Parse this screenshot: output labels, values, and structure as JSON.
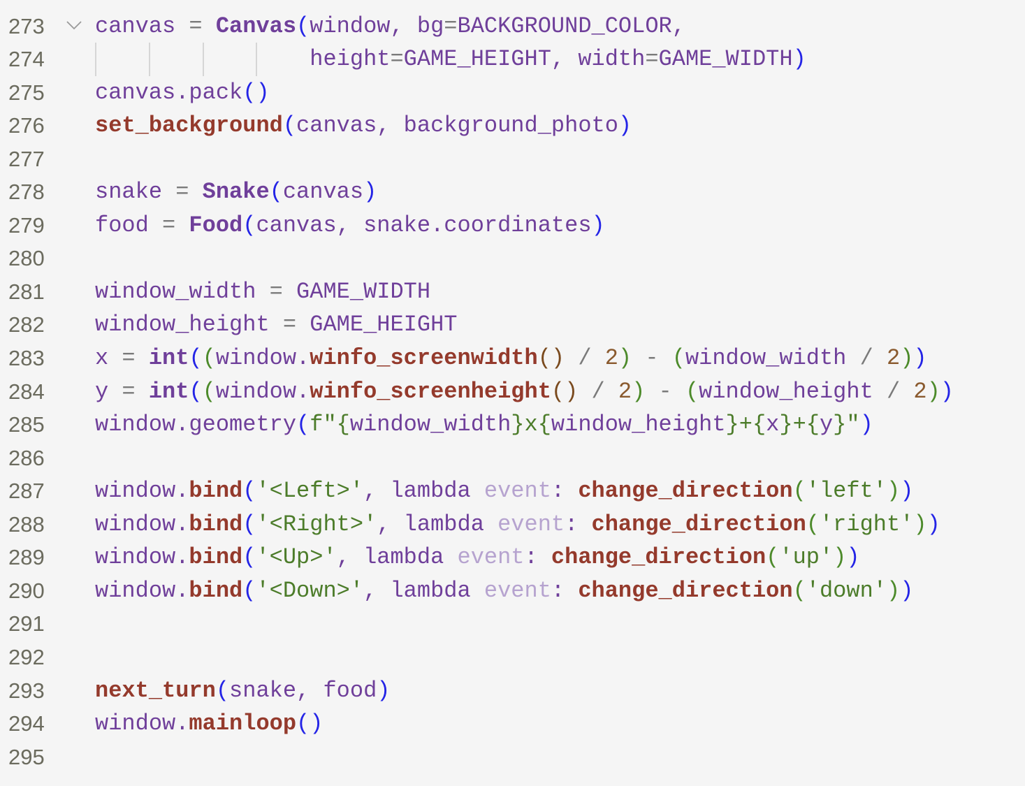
{
  "editor": {
    "language": "python",
    "first_line_number": 273,
    "lines": [
      {
        "n": "273",
        "fold": true,
        "tokens": [
          [
            "t-id",
            "canvas"
          ],
          [
            "t-op",
            " = "
          ],
          [
            "t-cls",
            "Canvas"
          ],
          [
            "t-p1",
            "("
          ],
          [
            "t-id",
            "window"
          ],
          [
            "t-punc",
            ", "
          ],
          [
            "t-id",
            "bg"
          ],
          [
            "t-op",
            "="
          ],
          [
            "t-id",
            "BACKGROUND_COLOR"
          ],
          [
            "t-punc",
            ","
          ]
        ]
      },
      {
        "n": "274",
        "guides": 4,
        "indent": "                ",
        "tokens": [
          [
            "t-id",
            "height"
          ],
          [
            "t-op",
            "="
          ],
          [
            "t-id",
            "GAME_HEIGHT"
          ],
          [
            "t-punc",
            ", "
          ],
          [
            "t-id",
            "width"
          ],
          [
            "t-op",
            "="
          ],
          [
            "t-id",
            "GAME_WIDTH"
          ],
          [
            "t-p1",
            ")"
          ]
        ]
      },
      {
        "n": "275",
        "tokens": [
          [
            "t-id",
            "canvas"
          ],
          [
            "t-punc",
            "."
          ],
          [
            "t-id",
            "pack"
          ],
          [
            "t-p1",
            "()"
          ]
        ]
      },
      {
        "n": "276",
        "tokens": [
          [
            "t-fn",
            "set_background"
          ],
          [
            "t-p1",
            "("
          ],
          [
            "t-id",
            "canvas"
          ],
          [
            "t-punc",
            ", "
          ],
          [
            "t-id",
            "background_photo"
          ],
          [
            "t-p1",
            ")"
          ]
        ]
      },
      {
        "n": "277",
        "tokens": []
      },
      {
        "n": "278",
        "tokens": [
          [
            "t-id",
            "snake"
          ],
          [
            "t-op",
            " = "
          ],
          [
            "t-cls",
            "Snake"
          ],
          [
            "t-p1",
            "("
          ],
          [
            "t-id",
            "canvas"
          ],
          [
            "t-p1",
            ")"
          ]
        ]
      },
      {
        "n": "279",
        "tokens": [
          [
            "t-id",
            "food"
          ],
          [
            "t-op",
            " = "
          ],
          [
            "t-cls",
            "Food"
          ],
          [
            "t-p1",
            "("
          ],
          [
            "t-id",
            "canvas"
          ],
          [
            "t-punc",
            ", "
          ],
          [
            "t-id",
            "snake.coordinates"
          ],
          [
            "t-p1",
            ")"
          ]
        ]
      },
      {
        "n": "280",
        "tokens": []
      },
      {
        "n": "281",
        "tokens": [
          [
            "t-id",
            "window_width"
          ],
          [
            "t-op",
            " = "
          ],
          [
            "t-id",
            "GAME_WIDTH"
          ]
        ]
      },
      {
        "n": "282",
        "tokens": [
          [
            "t-id",
            "window_height"
          ],
          [
            "t-op",
            " = "
          ],
          [
            "t-id",
            "GAME_HEIGHT"
          ]
        ]
      },
      {
        "n": "283",
        "tokens": [
          [
            "t-id",
            "x"
          ],
          [
            "t-op",
            " = "
          ],
          [
            "t-cls",
            "int"
          ],
          [
            "t-p1",
            "("
          ],
          [
            "t-p2",
            "("
          ],
          [
            "t-id",
            "window"
          ],
          [
            "t-punc",
            "."
          ],
          [
            "t-fn",
            "winfo_screenwidth"
          ],
          [
            "t-p3",
            "()"
          ],
          [
            "t-op",
            " / "
          ],
          [
            "t-num",
            "2"
          ],
          [
            "t-p2",
            ")"
          ],
          [
            "t-op",
            " - "
          ],
          [
            "t-p2",
            "("
          ],
          [
            "t-id",
            "window_width"
          ],
          [
            "t-op",
            " / "
          ],
          [
            "t-num",
            "2"
          ],
          [
            "t-p2",
            ")"
          ],
          [
            "t-p1",
            ")"
          ]
        ]
      },
      {
        "n": "284",
        "tokens": [
          [
            "t-id",
            "y"
          ],
          [
            "t-op",
            " = "
          ],
          [
            "t-cls",
            "int"
          ],
          [
            "t-p1",
            "("
          ],
          [
            "t-p2",
            "("
          ],
          [
            "t-id",
            "window"
          ],
          [
            "t-punc",
            "."
          ],
          [
            "t-fn",
            "winfo_screenheight"
          ],
          [
            "t-p3",
            "()"
          ],
          [
            "t-op",
            " / "
          ],
          [
            "t-num",
            "2"
          ],
          [
            "t-p2",
            ")"
          ],
          [
            "t-op",
            " - "
          ],
          [
            "t-p2",
            "("
          ],
          [
            "t-id",
            "window_height"
          ],
          [
            "t-op",
            " / "
          ],
          [
            "t-num",
            "2"
          ],
          [
            "t-p2",
            ")"
          ],
          [
            "t-p1",
            ")"
          ]
        ]
      },
      {
        "n": "285",
        "tokens": [
          [
            "t-id",
            "window"
          ],
          [
            "t-punc",
            "."
          ],
          [
            "t-id",
            "geometry"
          ],
          [
            "t-p1",
            "("
          ],
          [
            "t-str",
            "f\""
          ],
          [
            "t-str",
            "{"
          ],
          [
            "t-id",
            "window_width"
          ],
          [
            "t-str",
            "}x{"
          ],
          [
            "t-id",
            "window_height"
          ],
          [
            "t-str",
            "}+{"
          ],
          [
            "t-id",
            "x"
          ],
          [
            "t-str",
            "}+{"
          ],
          [
            "t-id",
            "y"
          ],
          [
            "t-str",
            "}\""
          ],
          [
            "t-p1",
            ")"
          ]
        ]
      },
      {
        "n": "286",
        "tokens": []
      },
      {
        "n": "287",
        "tokens": [
          [
            "t-id",
            "window"
          ],
          [
            "t-punc",
            "."
          ],
          [
            "t-fn",
            "bind"
          ],
          [
            "t-p1",
            "("
          ],
          [
            "t-str",
            "'<Left>'"
          ],
          [
            "t-punc",
            ", "
          ],
          [
            "t-kw",
            "lambda "
          ],
          [
            "t-param",
            "event"
          ],
          [
            "t-punc",
            ": "
          ],
          [
            "t-fn",
            "change_direction"
          ],
          [
            "t-p2",
            "("
          ],
          [
            "t-str",
            "'left'"
          ],
          [
            "t-p2",
            ")"
          ],
          [
            "t-p1",
            ")"
          ]
        ]
      },
      {
        "n": "288",
        "tokens": [
          [
            "t-id",
            "window"
          ],
          [
            "t-punc",
            "."
          ],
          [
            "t-fn",
            "bind"
          ],
          [
            "t-p1",
            "("
          ],
          [
            "t-str",
            "'<Right>'"
          ],
          [
            "t-punc",
            ", "
          ],
          [
            "t-kw",
            "lambda "
          ],
          [
            "t-param",
            "event"
          ],
          [
            "t-punc",
            ": "
          ],
          [
            "t-fn",
            "change_direction"
          ],
          [
            "t-p2",
            "("
          ],
          [
            "t-str",
            "'right'"
          ],
          [
            "t-p2",
            ")"
          ],
          [
            "t-p1",
            ")"
          ]
        ]
      },
      {
        "n": "289",
        "tokens": [
          [
            "t-id",
            "window"
          ],
          [
            "t-punc",
            "."
          ],
          [
            "t-fn",
            "bind"
          ],
          [
            "t-p1",
            "("
          ],
          [
            "t-str",
            "'<Up>'"
          ],
          [
            "t-punc",
            ", "
          ],
          [
            "t-kw",
            "lambda "
          ],
          [
            "t-param",
            "event"
          ],
          [
            "t-punc",
            ": "
          ],
          [
            "t-fn",
            "change_direction"
          ],
          [
            "t-p2",
            "("
          ],
          [
            "t-str",
            "'up'"
          ],
          [
            "t-p2",
            ")"
          ],
          [
            "t-p1",
            ")"
          ]
        ]
      },
      {
        "n": "290",
        "tokens": [
          [
            "t-id",
            "window"
          ],
          [
            "t-punc",
            "."
          ],
          [
            "t-fn",
            "bind"
          ],
          [
            "t-p1",
            "("
          ],
          [
            "t-str",
            "'<Down>'"
          ],
          [
            "t-punc",
            ", "
          ],
          [
            "t-kw",
            "lambda "
          ],
          [
            "t-param",
            "event"
          ],
          [
            "t-punc",
            ": "
          ],
          [
            "t-fn",
            "change_direction"
          ],
          [
            "t-p2",
            "("
          ],
          [
            "t-str",
            "'down'"
          ],
          [
            "t-p2",
            ")"
          ],
          [
            "t-p1",
            ")"
          ]
        ]
      },
      {
        "n": "291",
        "tokens": []
      },
      {
        "n": "292",
        "tokens": []
      },
      {
        "n": "293",
        "tokens": [
          [
            "t-fn",
            "next_turn"
          ],
          [
            "t-p1",
            "("
          ],
          [
            "t-id",
            "snake"
          ],
          [
            "t-punc",
            ", "
          ],
          [
            "t-id",
            "food"
          ],
          [
            "t-p1",
            ")"
          ]
        ]
      },
      {
        "n": "294",
        "tokens": [
          [
            "t-id",
            "window"
          ],
          [
            "t-punc",
            "."
          ],
          [
            "t-fn",
            "mainloop"
          ],
          [
            "t-p1",
            "()"
          ]
        ]
      },
      {
        "n": "295",
        "tokens": []
      }
    ],
    "fold_icon": "chevron-down-icon"
  }
}
